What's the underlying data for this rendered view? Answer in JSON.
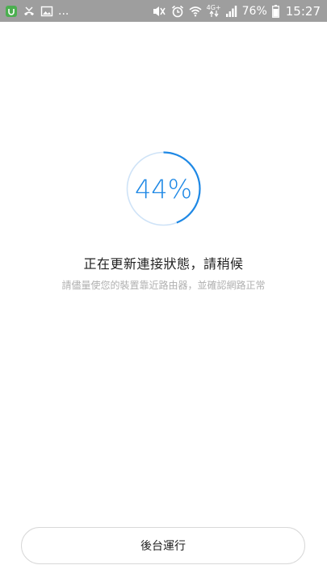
{
  "status_bar": {
    "left_icons": [
      "mi-app-icon",
      "missed-call-icon",
      "image-icon"
    ],
    "overflow": "...",
    "right_icons": [
      "mute-vibrate-icon",
      "alarm-icon",
      "wifi-icon",
      "network-4g-icon",
      "signal-icon"
    ],
    "network_label": "4G+",
    "battery_percent": "76%",
    "time": "15:27"
  },
  "progress": {
    "value": 44,
    "label": "44%",
    "color": "#1e88e5",
    "track_color": "#cfe3f7"
  },
  "message": {
    "title": "正在更新連接狀態，請稍候",
    "subtitle": "請儘量使您的裝置靠近路由器，並確認網路正常"
  },
  "actions": {
    "background_run": "後台運行"
  }
}
